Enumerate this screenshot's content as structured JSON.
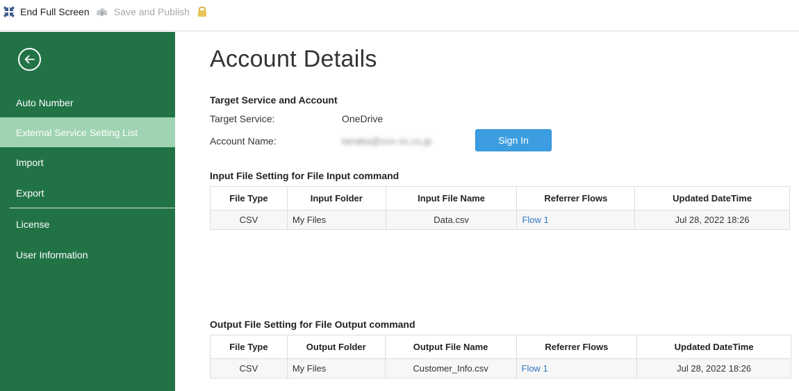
{
  "toolbar": {
    "end_fullscreen_label": "End Full Screen",
    "save_publish_label": "Save and Publish"
  },
  "sidebar": {
    "items": [
      {
        "label": "Auto Number",
        "active": false
      },
      {
        "label": "External Service Setting List",
        "active": true
      },
      {
        "label": "Import",
        "active": false
      },
      {
        "label": "Export",
        "active": false
      },
      {
        "label": "License",
        "active": false
      },
      {
        "label": "User Information",
        "active": false
      }
    ]
  },
  "main": {
    "title": "Account Details",
    "target_section": {
      "title": "Target Service and Account",
      "target_service_label": "Target Service:",
      "target_service_value": "OneDrive",
      "account_name_label": "Account Name:",
      "account_name_value": "tanaka@xxx-xx.co.jp",
      "sign_in_label": "Sign In"
    },
    "input_section": {
      "title": "Input File Setting for File Input command",
      "headers": [
        "File Type",
        "Input Folder",
        "Input File Name",
        "Referrer Flows",
        "Updated DateTime"
      ],
      "rows": [
        {
          "file_type": "CSV",
          "folder": "My Files",
          "file_name": "Data.csv",
          "flow": "Flow 1",
          "updated": "Jul 28, 2022 18:26"
        }
      ]
    },
    "output_section": {
      "title": "Output File Setting for File Output command",
      "headers": [
        "File Type",
        "Output Folder",
        "Output File Name",
        "Referrer Flows",
        "Updated DateTime"
      ],
      "rows": [
        {
          "file_type": "CSV",
          "folder": "My Files",
          "file_name": "Customer_Info.csv",
          "flow": "Flow 1",
          "updated": "Jul 28, 2022 18:26"
        }
      ]
    }
  },
  "colors": {
    "sidebar_bg": "#217346",
    "sidebar_active": "#9fd3b2",
    "button_blue": "#3c9ee0",
    "link_blue": "#2f77c1"
  }
}
